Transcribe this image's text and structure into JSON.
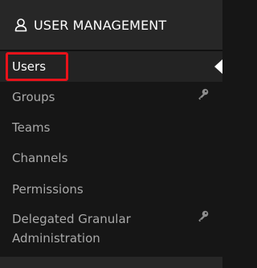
{
  "header": {
    "icon": "user-icon",
    "title": "USER MANAGEMENT"
  },
  "menu": {
    "items": [
      {
        "label": "Users",
        "active": true
      },
      {
        "label": "Groups",
        "icon": "key-icon"
      },
      {
        "label": "Teams"
      },
      {
        "label": "Channels"
      },
      {
        "label": "Permissions"
      },
      {
        "label": "Delegated Granular Administration",
        "icon": "key-icon"
      }
    ]
  },
  "colors": {
    "background": "#161616",
    "header": "#272727",
    "active_item": "#232323",
    "text": "#a9a9a9",
    "active_text": "#ffffff",
    "highlight": "#e8121a"
  }
}
